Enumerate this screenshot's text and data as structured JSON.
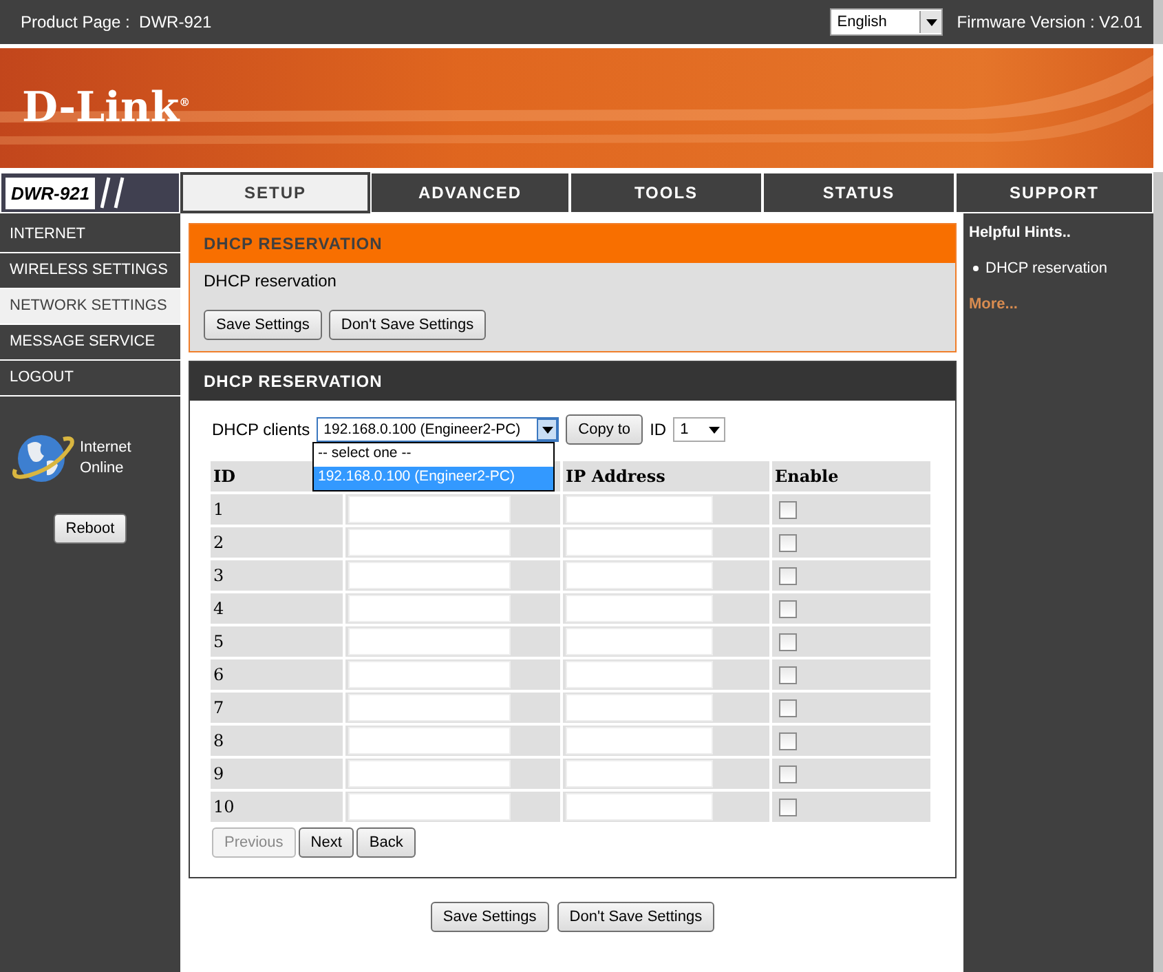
{
  "header": {
    "product_label": "Product Page :",
    "product": "DWR-921",
    "language": "English",
    "firmware": "Firmware Version : V2.01"
  },
  "logo": {
    "name": "D-Link",
    "mark": "®"
  },
  "model_badge": "DWR-921",
  "tabs": [
    {
      "label": "SETUP",
      "selected": true
    },
    {
      "label": "ADVANCED",
      "selected": false
    },
    {
      "label": "TOOLS",
      "selected": false
    },
    {
      "label": "STATUS",
      "selected": false
    },
    {
      "label": "SUPPORT",
      "selected": false
    }
  ],
  "sidebar": {
    "items": [
      {
        "label": "INTERNET",
        "selected": false
      },
      {
        "label": "WIRELESS SETTINGS",
        "selected": false
      },
      {
        "label": "NETWORK SETTINGS",
        "selected": true
      },
      {
        "label": "MESSAGE SERVICE",
        "selected": false
      },
      {
        "label": "LOGOUT",
        "selected": false
      }
    ],
    "status_lines": [
      "Internet",
      "Online"
    ],
    "reboot": "Reboot"
  },
  "intro": {
    "title": "DHCP RESERVATION",
    "text": "DHCP reservation",
    "buttons": [
      "Save Settings",
      "Don't Save Settings"
    ]
  },
  "reservation": {
    "title": "DHCP RESERVATION",
    "clients_label": "DHCP clients",
    "client_value": "192.168.0.100 (Engineer2-PC)",
    "copy_button": "Copy to",
    "id_label": "ID",
    "id_value": "1",
    "dropdown_options": [
      {
        "label": "-- select one --",
        "selected": false
      },
      {
        "label": "192.168.0.100 (Engineer2-PC)",
        "selected": true
      }
    ],
    "id_header": "ID",
    "ip_header": "IP Address",
    "enable_header": "Enable",
    "rows": [
      {
        "id": "1",
        "enabled": false
      },
      {
        "id": "2",
        "enabled": false
      },
      {
        "id": "3",
        "enabled": false
      },
      {
        "id": "4",
        "enabled": false
      },
      {
        "id": "5",
        "enabled": false
      },
      {
        "id": "6",
        "enabled": false
      },
      {
        "id": "7",
        "enabled": false
      },
      {
        "id": "8",
        "enabled": false
      },
      {
        "id": "9",
        "enabled": false
      },
      {
        "id": "10",
        "enabled": false
      }
    ],
    "pager": [
      {
        "label": "Previous",
        "disabled": true
      },
      {
        "label": "Next",
        "disabled": false
      },
      {
        "label": "Back",
        "disabled": false
      }
    ]
  },
  "bottom_buttons": [
    "Save Settings",
    "Don't Save Settings"
  ],
  "hints": {
    "title": "Helpful Hints..",
    "items": [
      "DHCP reservation"
    ],
    "more": "More..."
  }
}
